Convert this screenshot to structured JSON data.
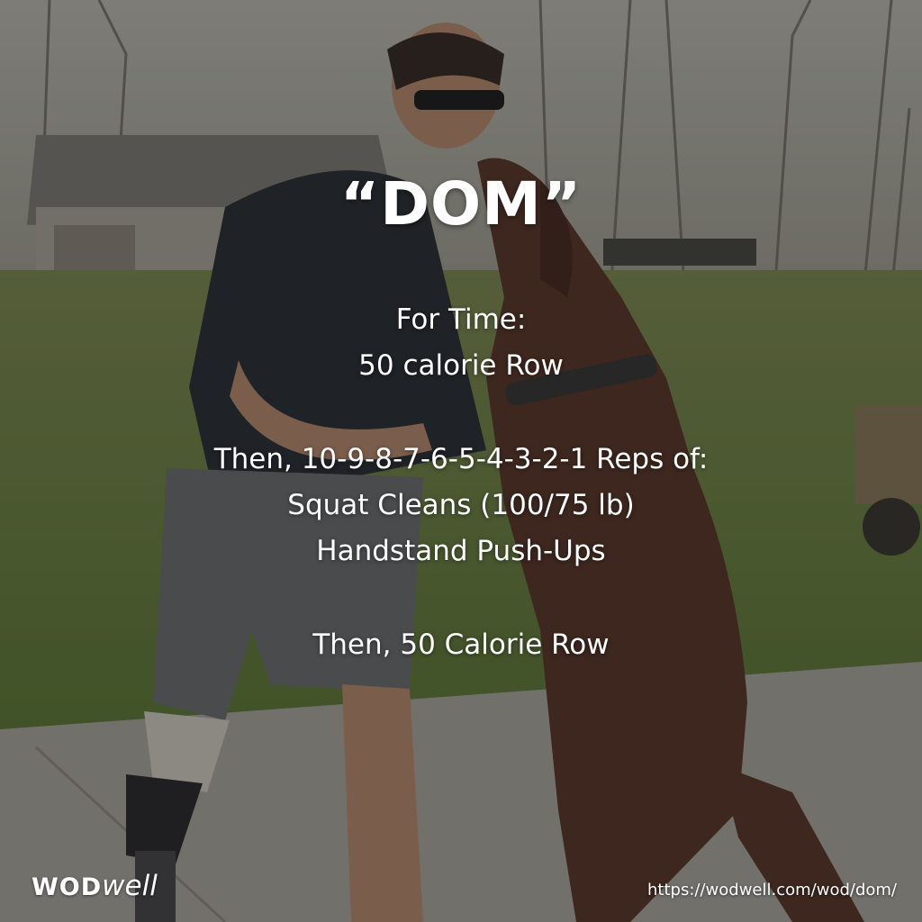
{
  "title": "“DOM”",
  "workout": {
    "line1": "For Time:",
    "line2": "50 calorie Row",
    "line3": "Then, 10-9-8-7-6-5-4-3-2-1 Reps of:",
    "line4": "Squat Cleans (100/75 lb)",
    "line5": "Handstand Push-Ups",
    "line6": "Then, 50 Calorie Row"
  },
  "logo": {
    "bold": "WOD",
    "italic": "well"
  },
  "url": "https://wodwell.com/wod/dom/"
}
